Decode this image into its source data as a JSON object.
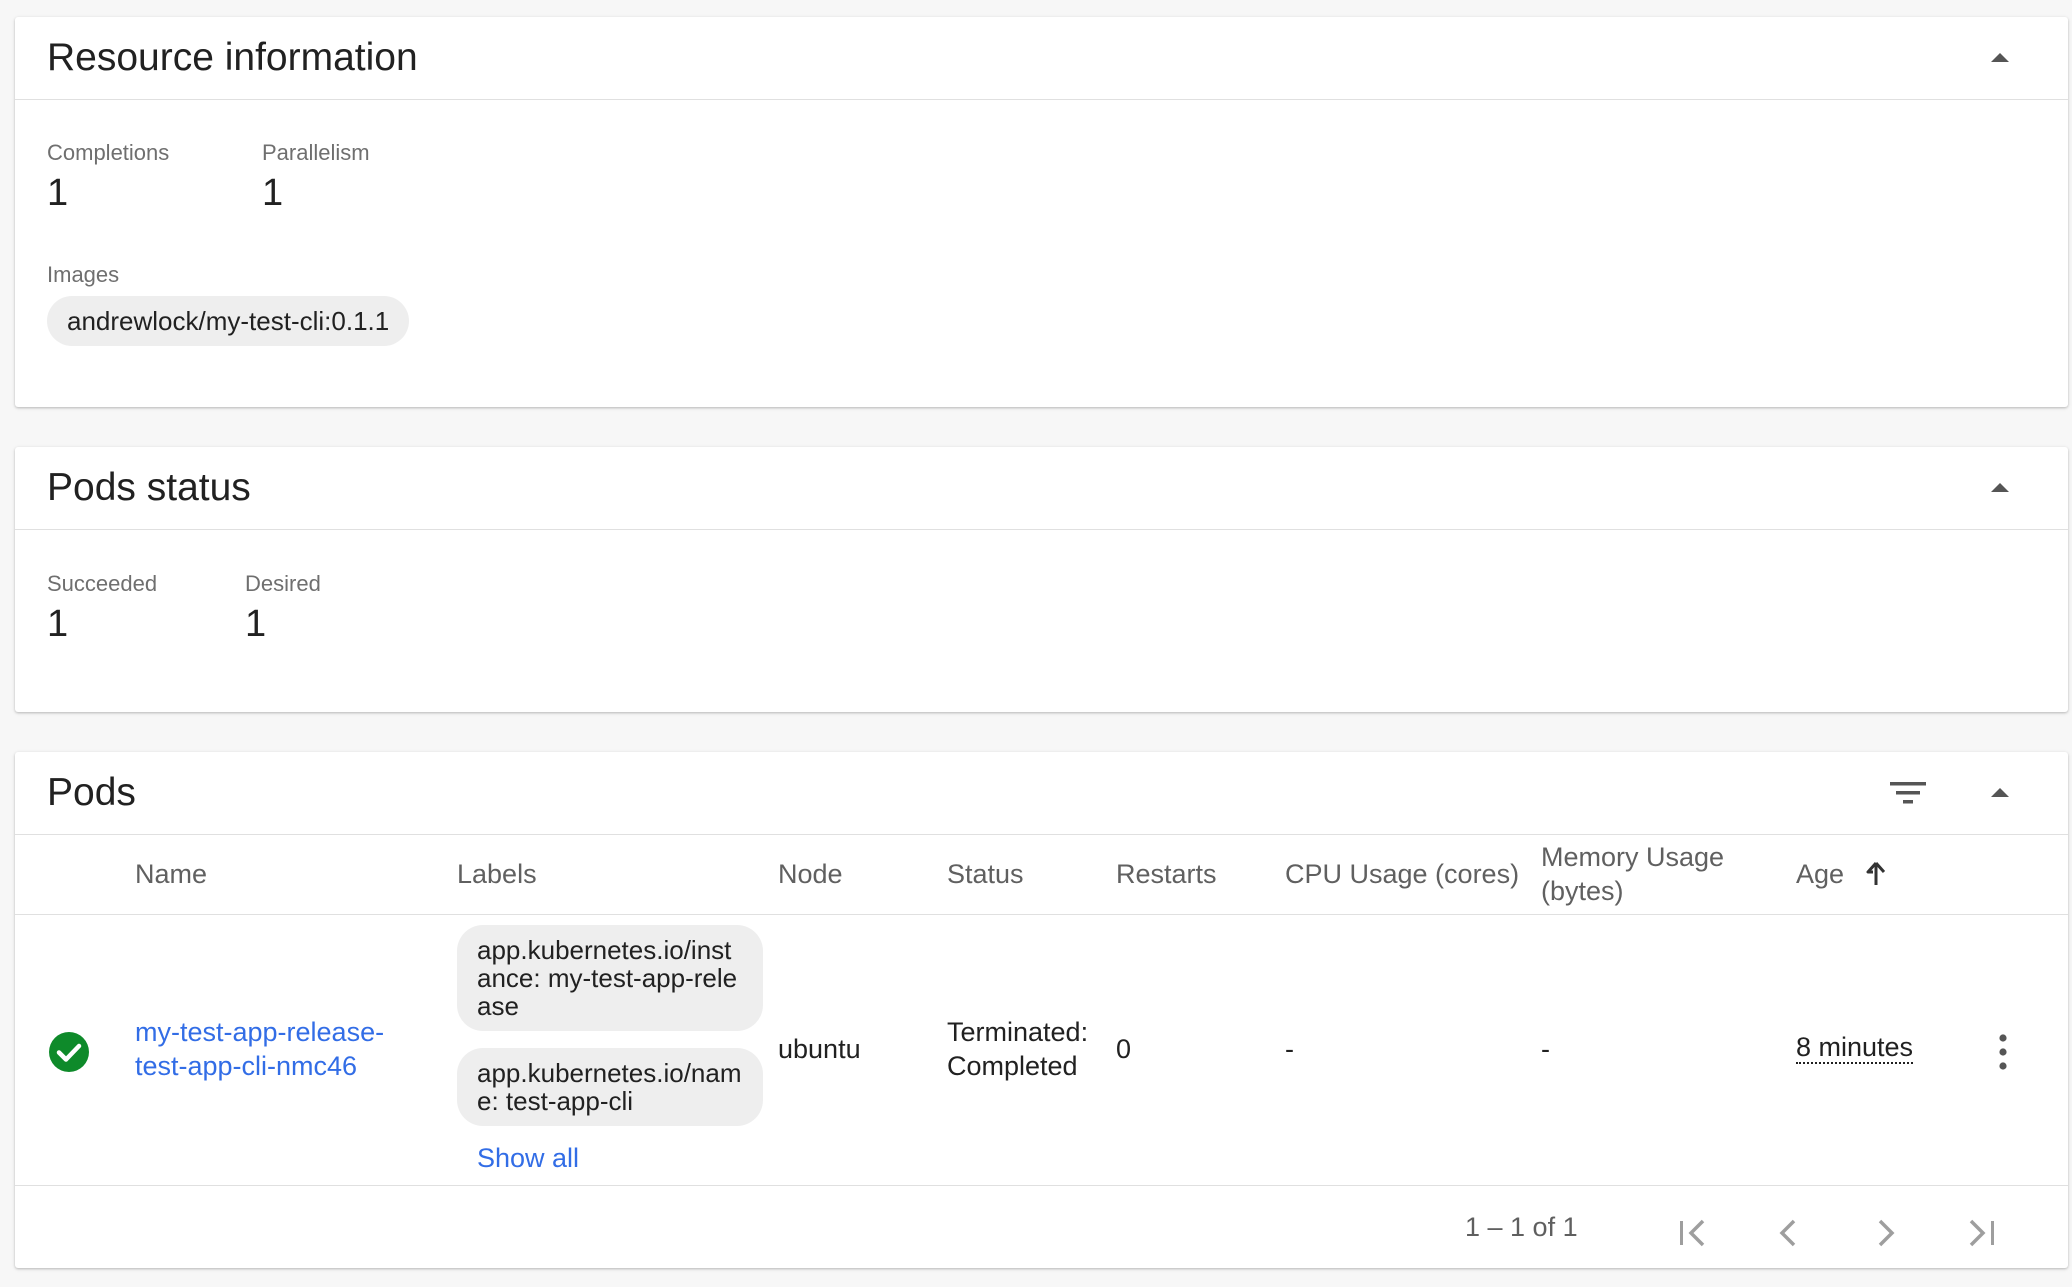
{
  "resource_info": {
    "title": "Resource information",
    "completions_label": "Completions",
    "completions_value": "1",
    "parallelism_label": "Parallelism",
    "parallelism_value": "1",
    "images_label": "Images",
    "images": [
      "andrewlock/my-test-cli:0.1.1"
    ]
  },
  "pods_status": {
    "title": "Pods status",
    "succeeded_label": "Succeeded",
    "succeeded_value": "1",
    "desired_label": "Desired",
    "desired_value": "1"
  },
  "pods": {
    "title": "Pods",
    "columns": {
      "name": "Name",
      "labels": "Labels",
      "node": "Node",
      "status": "Status",
      "restarts": "Restarts",
      "cpu": "CPU Usage (cores)",
      "memory": "Memory Usage (bytes)",
      "age": "Age"
    },
    "rows": [
      {
        "status_icon": "check-circle-icon",
        "name": "my-test-app-release-test-app-cli-nmc46",
        "labels": [
          "app.kubernetes.io/instance: my-test-app-release",
          "app.kubernetes.io/name: test-app-cli"
        ],
        "show_all": "Show all",
        "node": "ubuntu",
        "status": "Terminated: Completed",
        "restarts": "0",
        "cpu": "-",
        "memory": "-",
        "age": "8 minutes"
      }
    ],
    "pagination": "1 – 1 of 1"
  },
  "colors": {
    "link": "#326de6",
    "success": "#0e8a2a"
  }
}
